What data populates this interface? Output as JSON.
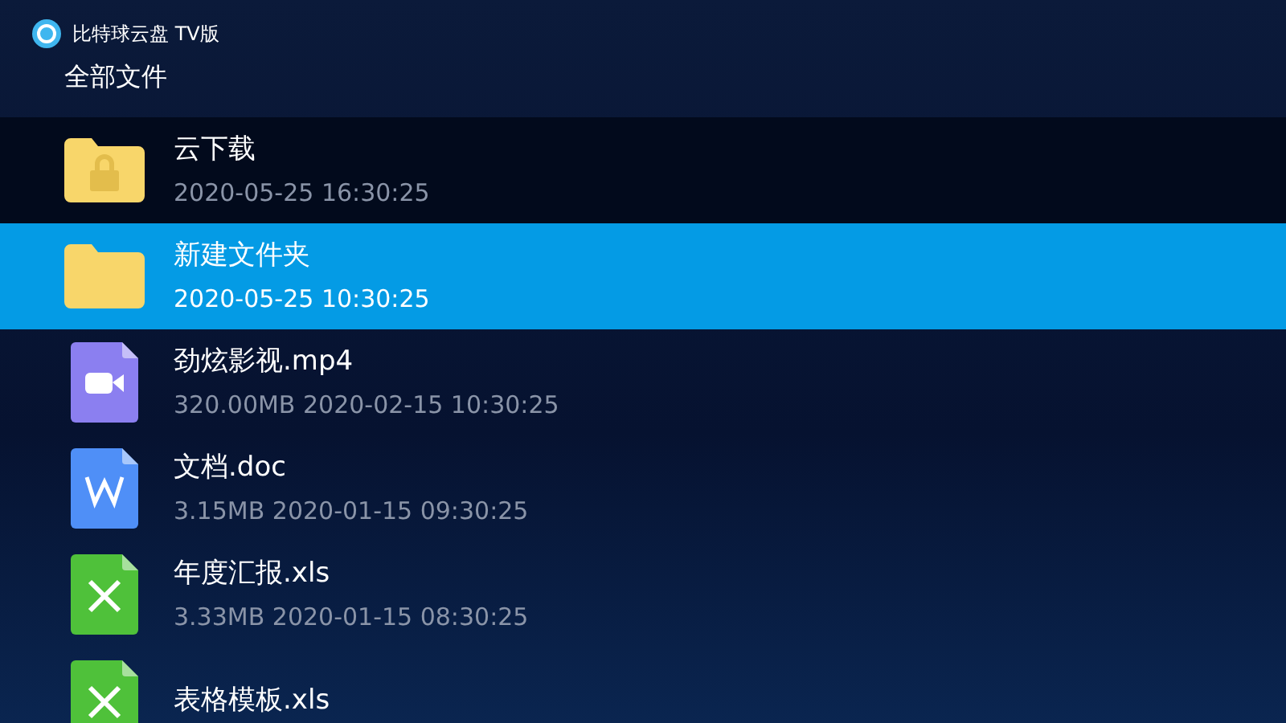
{
  "app": {
    "title": "比特球云盘 TV版"
  },
  "breadcrumb": "全部文件",
  "files": [
    {
      "kind": "locked-folder",
      "name": "云下载",
      "meta": "2020-05-25 16:30:25",
      "selected": false
    },
    {
      "kind": "folder",
      "name": "新建文件夹",
      "meta": "2020-05-25 10:30:25",
      "selected": true
    },
    {
      "kind": "video",
      "name": "劲炫影视.mp4",
      "meta": "320.00MB 2020-02-15 10:30:25",
      "selected": false
    },
    {
      "kind": "doc",
      "name": "文档.doc",
      "meta": "3.15MB 2020-01-15 09:30:25",
      "selected": false
    },
    {
      "kind": "sheet",
      "name": "年度汇报.xls",
      "meta": "3.33MB 2020-01-15 08:30:25",
      "selected": false
    },
    {
      "kind": "sheet",
      "name": "表格模板.xls",
      "selected": false
    }
  ]
}
